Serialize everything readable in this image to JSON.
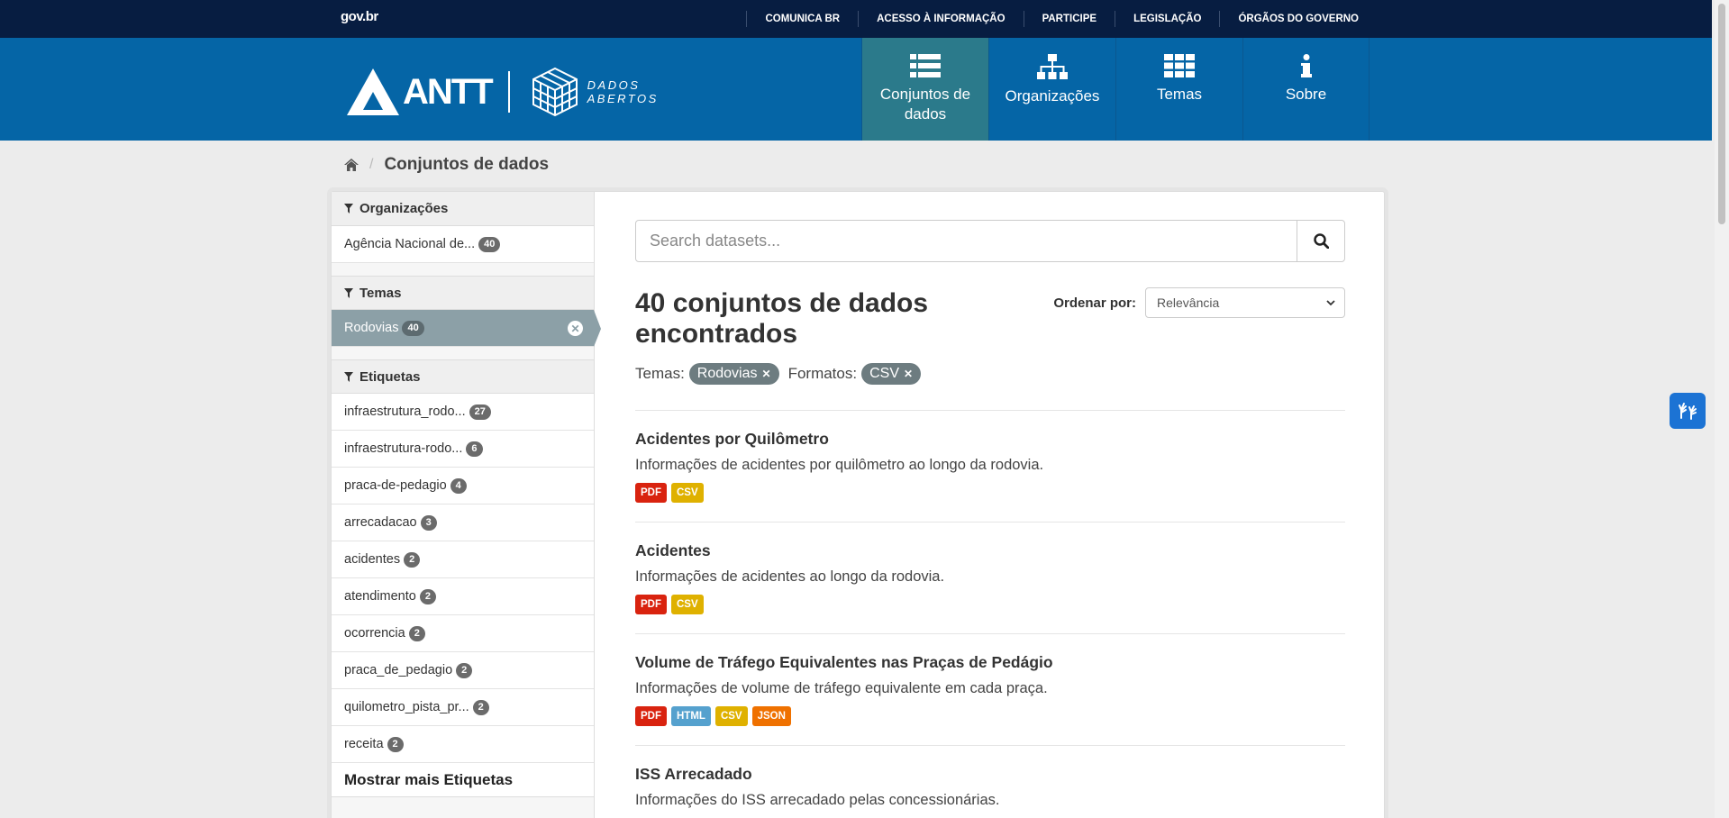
{
  "govbar": {
    "logo": "gov.br",
    "links": [
      "COMUNICA BR",
      "ACESSO À INFORMAÇÃO",
      "PARTICIPE",
      "LEGISLAÇÃO",
      "ÓRGÃOS DO GOVERNO"
    ]
  },
  "brand": {
    "name": "ANTT",
    "tag_line1": "DADOS",
    "tag_line2": "ABERTOS"
  },
  "nav": [
    {
      "label": "Conjuntos de dados",
      "icon": "list-icon",
      "active": true
    },
    {
      "label": "Organizações",
      "icon": "sitemap-icon",
      "active": false
    },
    {
      "label": "Temas",
      "icon": "grid-icon",
      "active": false
    },
    {
      "label": "Sobre",
      "icon": "info-icon",
      "active": false
    }
  ],
  "breadcrumb": {
    "home_icon": "home-icon",
    "current": "Conjuntos de dados"
  },
  "sidebar": {
    "organizacoes": {
      "title": "Organizações",
      "items": [
        {
          "label": "Agência Nacional de...",
          "count": "40"
        }
      ]
    },
    "temas": {
      "title": "Temas",
      "items": [
        {
          "label": "Rodovias",
          "count": "40"
        }
      ]
    },
    "etiquetas": {
      "title": "Etiquetas",
      "items": [
        {
          "label": "infraestrutura_rodo...",
          "count": "27"
        },
        {
          "label": "infraestrutura-rodo...",
          "count": "6"
        },
        {
          "label": "praca-de-pedagio",
          "count": "4"
        },
        {
          "label": "arrecadacao",
          "count": "3"
        },
        {
          "label": "acidentes",
          "count": "2"
        },
        {
          "label": "atendimento",
          "count": "2"
        },
        {
          "label": "ocorrencia",
          "count": "2"
        },
        {
          "label": "praca_de_pedagio",
          "count": "2"
        },
        {
          "label": "quilometro_pista_pr...",
          "count": "2"
        },
        {
          "label": "receita",
          "count": "2"
        }
      ],
      "show_more": "Mostrar mais Etiquetas"
    }
  },
  "main": {
    "search_placeholder": "Search datasets...",
    "result_count": "40 conjuntos de dados encontrados",
    "order_label": "Ordenar por:",
    "order_value": "Relevância",
    "filters": [
      {
        "label": "Temas:",
        "value": "Rodovias"
      },
      {
        "label": "Formatos:",
        "value": "CSV"
      }
    ],
    "datasets": [
      {
        "title": "Acidentes por Quilômetro",
        "desc": "Informações de acidentes por quilômetro ao longo da rodovia.",
        "formats": [
          "PDF",
          "CSV"
        ]
      },
      {
        "title": "Acidentes",
        "desc": "Informações de acidentes ao longo da rodovia.",
        "formats": [
          "PDF",
          "CSV"
        ]
      },
      {
        "title": "Volume de Tráfego Equivalentes nas Praças de Pedágio",
        "desc": "Informações de volume de tráfego equivalente em cada praça.",
        "formats": [
          "PDF",
          "HTML",
          "CSV",
          "JSON"
        ]
      },
      {
        "title": "ISS Arrecadado",
        "desc": "Informações do ISS arrecadado pelas concessionárias.",
        "formats": []
      }
    ]
  },
  "colors": {
    "govbar": "#071d41",
    "masthead": "#0565a6",
    "nav_active": "#2b7a8b",
    "PDF": "#d9230f",
    "CSV": "#dfb100",
    "HTML": "#55a1ce",
    "JSON": "#ef7100"
  }
}
